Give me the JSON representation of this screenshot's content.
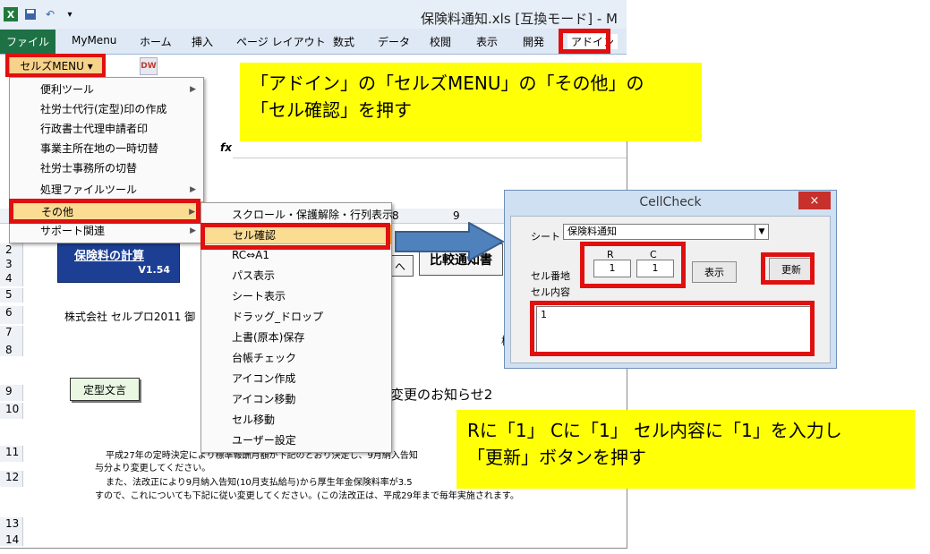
{
  "window": {
    "title": "保険料通知.xls  [互換モード] - M"
  },
  "ribbon": {
    "file_tab": "ファイル",
    "tabs": [
      "MyMenu",
      "ホーム",
      "挿入",
      "ページ レイアウト",
      "数式",
      "データ",
      "校閲",
      "表示",
      "開発",
      "アドイン"
    ],
    "addin_menu_label": "セルズMENU ▾",
    "dw_icon_label": "DW"
  },
  "formula_bar": {
    "fx": "fx"
  },
  "column_headers": [
    "8",
    "9"
  ],
  "row_headers": [
    "2",
    "3",
    "4",
    "5",
    "6",
    "7",
    "8",
    "9",
    "10",
    "11",
    "12",
    "13",
    "14"
  ],
  "sheet": {
    "calc_title": "保険料の計算",
    "calc_version": "V1.54",
    "company_line": "株式会社  セルプロ2011 御",
    "fixed_text_button": "定型文言",
    "notice_title": "変更のお知らせ2",
    "compare_button": "比較通知書",
    "arrow_button": "へ",
    "side_char": "様",
    "para_line1": "平成27年の定時決定により標準報酬月額が下記のとおり決定し、9月納入告知",
    "para_line2": "与分より変更してください。",
    "para_line3": "また、法改正により9月納入告知(10月支払給与)から厚生年金保険料率が3.5",
    "para_line4": "すので、これについても下記に従い変更してください。(この法改正は、平成29年まで毎年実施されます。"
  },
  "main_menu": {
    "items": [
      {
        "label": "便利ツール",
        "submenu": true
      },
      {
        "label": "社労士代行(定型)印の作成",
        "submenu": false
      },
      {
        "label": "行政書士代理申請者印",
        "submenu": false
      },
      {
        "label": "事業主所在地の一時切替",
        "submenu": false
      },
      {
        "label": "社労士事務所の切替",
        "submenu": false
      },
      {
        "label": "処理ファイルツール",
        "submenu": true
      },
      {
        "label": "その他",
        "submenu": true
      },
      {
        "label": "サポート関連",
        "submenu": true
      }
    ]
  },
  "sub_menu": {
    "items": [
      "スクロール・保護解除・行列表示",
      "セル確認",
      "RC⇔A1",
      "パス表示",
      "シート表示",
      "ドラッグ_ドロップ",
      "上書(原本)保存",
      "台帳チェック",
      "アイコン作成",
      "アイコン移動",
      "セル移動",
      "ユーザー設定"
    ]
  },
  "dialog": {
    "title": "CellCheck",
    "close": "×",
    "sheet_label": "シート",
    "sheet_value": "保険料通知",
    "r_label": "R",
    "c_label": "C",
    "address_label": "セル番地",
    "r_value": "1",
    "c_value": "1",
    "show_button": "表示",
    "update_button": "更新",
    "content_label": "セル内容",
    "content_value": "1"
  },
  "notes": {
    "top_line1": "「アドイン」の「セルズMENU」の「その他」の",
    "top_line2": "「セル確認」を押す",
    "bottom_line1": "Rに「1」 Cに「1」 セル内容に「1」を入力し",
    "bottom_line2": "「更新」ボタンを押す"
  },
  "colors": {
    "callout_red": "#e01010",
    "note_yellow": "#ffff05",
    "file_tab_green": "#1e7145",
    "menu_highlight": "#fbdc93",
    "arrow_blue": "#4f81bd"
  }
}
